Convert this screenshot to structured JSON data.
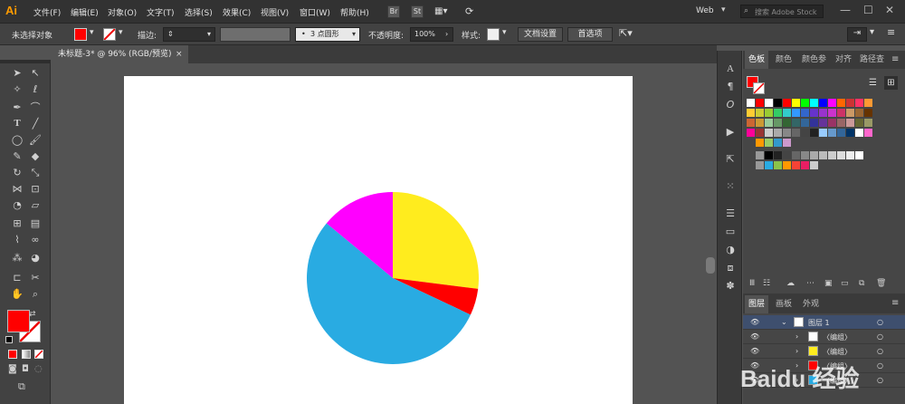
{
  "app": {
    "logo": "Ai",
    "menus": [
      "文件(F)",
      "编辑(E)",
      "对象(O)",
      "文字(T)",
      "选择(S)",
      "效果(C)",
      "视图(V)",
      "窗口(W)",
      "帮助(H)"
    ],
    "bridge": "Br",
    "stock": "St",
    "workspace": "Web",
    "search_placeholder": "搜索 Adobe Stock"
  },
  "control_bar": {
    "selection_status": "未选择对象",
    "stroke_label": "描边:",
    "brush_value": "3 点圆形",
    "opacity_label": "不透明度:",
    "opacity_value": "100%",
    "style_label": "样式:",
    "doc_settings": "文档设置",
    "preferences": "首选项"
  },
  "document": {
    "tab_title": "未标题-3* @ 96% (RGB/预览)",
    "close": "×"
  },
  "color_panel": {
    "tabs": [
      "色板",
      "颜色",
      "颜色参",
      "对齐",
      "路径查"
    ],
    "fill_color": "#ff0000"
  },
  "layers_panel": {
    "tabs": [
      "图层",
      "画板",
      "外观"
    ],
    "rows": [
      {
        "name": "图层 1",
        "thumb": "#ffffff"
      },
      {
        "name": "〈编组〉",
        "thumb": "#ffffff"
      },
      {
        "name": "〈编组〉",
        "thumb": "#ffec1e"
      },
      {
        "name": "〈编组〉",
        "thumb": "#ff0000"
      },
      {
        "name": "〈编组〉",
        "thumb": "#29abe2"
      }
    ]
  },
  "chart_data": {
    "type": "pie",
    "title": "",
    "slices": [
      {
        "label": "",
        "value": 27,
        "color": "#ffec1e"
      },
      {
        "label": "",
        "value": 5,
        "color": "#ff0000"
      },
      {
        "label": "",
        "value": 54,
        "color": "#29abe2"
      },
      {
        "label": "",
        "value": 14,
        "color": "#ff00ff"
      }
    ]
  },
  "watermark": "Baidu 经验"
}
